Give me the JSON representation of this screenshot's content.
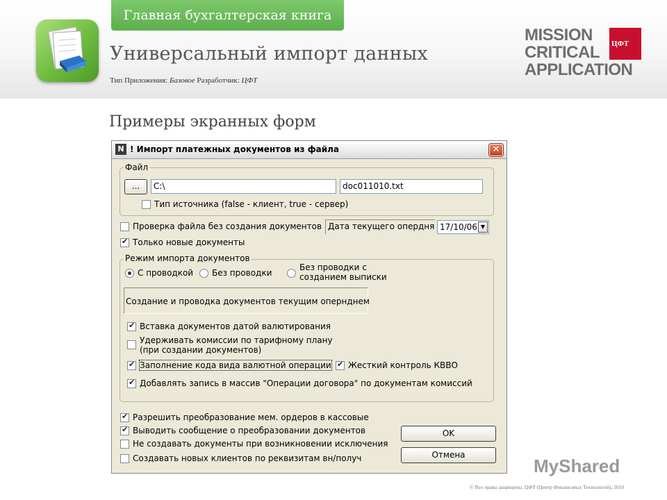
{
  "header": {
    "tab_label": "Главная бухгалтерская книга",
    "app_title": "Универсальный импорт данных",
    "meta_type_label": "Тип Приложения:",
    "meta_type_value": "Базовое",
    "meta_dev_label": "Разработчик:",
    "meta_dev_value": "ЦФТ",
    "mca_line1": "MISSION",
    "mca_line2": "CRITICAL",
    "mca_line3": "APPLICATION",
    "cft_logo_text": "ЦФТ"
  },
  "section_title": "Примеры экранных форм",
  "dialog": {
    "title": "! Импорт платежных документов из файла",
    "close_label": "✕",
    "file_group": {
      "legend": "Файл",
      "browse_label": "...",
      "path_value": "C:\\",
      "filename_value": "doc011010.txt",
      "source_type_label": "Тип источника (false - клиент, true - сервер)",
      "source_type_checked": false
    },
    "check_file_label": "Проверка файла без создания документов",
    "check_file_checked": false,
    "date_label": "Дата текущего опердня",
    "date_value": "17/10/06",
    "only_new_label": "Только новые документы",
    "only_new_checked": true,
    "mode_group": {
      "legend": "Режим импорта документов",
      "radio_with_posting": "С проводкой",
      "radio_without_posting": "Без проводки",
      "radio_without_posting_statement": "Без проводки с созданием выписки",
      "selected": "radio_with_posting",
      "description": "Создание и проводка документов текущим опернднем",
      "opt_value_date_label": "Вставка документов датой валютирования",
      "opt_value_date_checked": true,
      "opt_commission_label": "Удерживать комиссии по тарифному плану (при создании документов)",
      "opt_commission_checked": false,
      "opt_currency_code_label": "Заполнение кода вида валютной операции",
      "opt_currency_code_checked": true,
      "opt_kvvo_label": "Жесткий контроль КВВО",
      "opt_kvvo_checked": true,
      "opt_contract_ops_label": "Добавлять запись в массив \"Операции договора\" по документам комиссий",
      "opt_contract_ops_checked": true
    },
    "allow_convert_label": "Разрешить преобразование мем. ордеров в кассовые",
    "allow_convert_checked": true,
    "show_message_label": "Выводить сообщение о преобразовании документов",
    "show_message_checked": true,
    "no_create_on_exception_label": "Не создавать документы при возникновении исключения",
    "no_create_on_exception_checked": false,
    "create_clients_label": "Создавать новых клиентов по реквизитам вн/получ",
    "create_clients_checked": false,
    "ok_label": "OK",
    "cancel_label": "Отмена"
  },
  "watermark": "MyShared",
  "copyright": "© Все права защищены, ЦФТ (Центр Финансовых Технологий), 2010",
  "colors": {
    "tab_green": "#6dbb5a",
    "logo_red": "#c8102e",
    "dialog_bg": "#ece9d8"
  }
}
